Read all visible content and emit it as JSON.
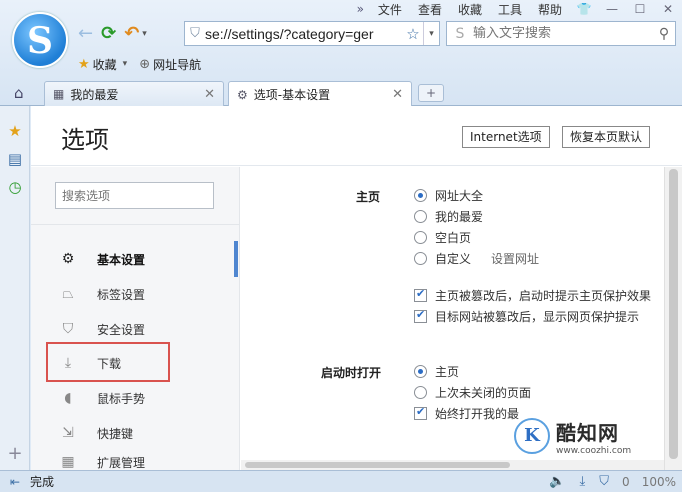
{
  "browser": {
    "logo_letter": "S",
    "menu": {
      "more": "»",
      "items": [
        "文件",
        "查看",
        "收藏",
        "工具",
        "帮助"
      ],
      "skin": "👕",
      "minimize": "—",
      "maximize": "☐",
      "close": "✕"
    },
    "nav": {
      "back": "←",
      "refresh": "⟳",
      "undo": "↶",
      "undo_caret": "▾"
    },
    "address": {
      "url": "se://settings/?category=ger",
      "star": "☆",
      "dropdown": "▾",
      "shield": "⛉"
    },
    "search": {
      "placeholder": "输入文字搜索",
      "engine_icon": "S"
    },
    "bookmarks": {
      "favorites": "收藏",
      "favorites_caret": "▾",
      "site_nav": "网址导航"
    },
    "tabs": [
      {
        "label": "我的最爱",
        "icon": "▦",
        "close": "✕"
      },
      {
        "label": "选项-基本设置",
        "icon": "⚙",
        "close": "✕"
      }
    ],
    "new_tab": "+",
    "home": "⌂"
  },
  "sidebar_strip": {
    "plus": "+"
  },
  "page": {
    "title": "选项",
    "internet_options": "Internet选项",
    "restore_default": "恢复本页默认",
    "search_placeholder": "搜索选项",
    "menu": [
      {
        "label": "基本设置",
        "icon": "⚙"
      },
      {
        "label": "标签设置",
        "icon": "⏢"
      },
      {
        "label": "安全设置",
        "icon": "⛉"
      },
      {
        "label": "下载",
        "icon": "⤓"
      },
      {
        "label": "鼠标手势",
        "icon": "◖"
      },
      {
        "label": "快捷键",
        "icon": "⇲"
      },
      {
        "label": "扩展管理",
        "icon": "▦"
      }
    ],
    "homepage": {
      "label": "主页",
      "options": [
        "网址大全",
        "我的最爱",
        "空白页",
        "自定义"
      ],
      "selected": 0,
      "set_url": "设置网址",
      "checks": [
        {
          "label": "主页被篡改后，启动时提示主页保护效果",
          "checked": true
        },
        {
          "label": "目标网站被篡改后，显示网页保护提示",
          "checked": true
        }
      ]
    },
    "startup": {
      "label": "启动时打开",
      "options": [
        "主页",
        "上次未关闭的页面"
      ],
      "selected": 0,
      "check": {
        "label": "始终打开我的最",
        "checked": true
      }
    }
  },
  "watermark": {
    "badge": "K",
    "name": "酷知网",
    "url": "www.coozhi.com"
  },
  "status": {
    "text": "完成",
    "zoom": "100%",
    "count": "0"
  }
}
